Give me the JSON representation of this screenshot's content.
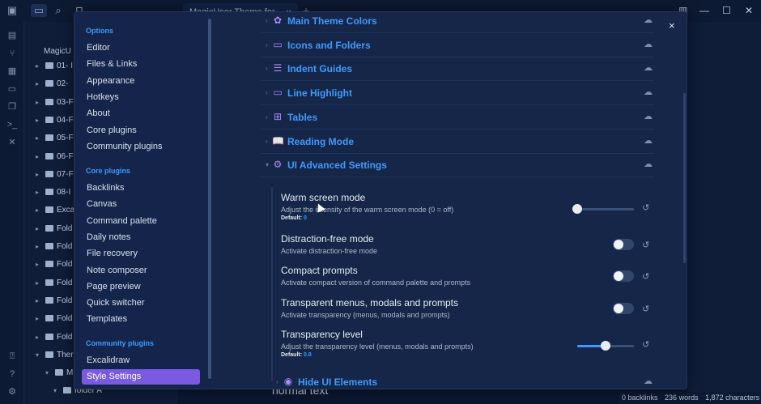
{
  "titlebar": {
    "tab_title": "MagicUser Theme for ...",
    "tab_close": "×",
    "tab_plus": "+",
    "icons": [
      "sidebar-toggle-icon",
      "folder-icon",
      "search-icon",
      "bookmark-icon"
    ],
    "window_controls": {
      "chevron": "⌄",
      "layout": "▥",
      "minimize": "—",
      "maximize": "☐",
      "close": "✕"
    }
  },
  "ribbon": {
    "icons": [
      "file-icon",
      "graph-icon",
      "blocks-icon",
      "calendar-icon",
      "copy-icon",
      "terminal-icon",
      "tools-icon",
      "help-icon",
      "question-icon",
      "settings-icon"
    ]
  },
  "explorer": {
    "vault": "MagicU",
    "rows": [
      {
        "label": "01- I",
        "expanded": false
      },
      {
        "label": "02- ",
        "expanded": false
      },
      {
        "label": "03-F",
        "expanded": false
      },
      {
        "label": "04-F",
        "expanded": false
      },
      {
        "label": "05-F",
        "expanded": false
      },
      {
        "label": "06-F",
        "expanded": false
      },
      {
        "label": "07-F",
        "expanded": false
      },
      {
        "label": "08-I",
        "expanded": false
      },
      {
        "label": "Exca",
        "expanded": false
      },
      {
        "label": "Fold",
        "expanded": false
      },
      {
        "label": "Fold",
        "expanded": false
      },
      {
        "label": "Fold",
        "expanded": false
      },
      {
        "label": "Fold",
        "expanded": false
      },
      {
        "label": "Fold",
        "expanded": false
      },
      {
        "label": "Fold",
        "expanded": false
      },
      {
        "label": "Fold",
        "expanded": false
      },
      {
        "label": "Ther",
        "expanded": true
      },
      {
        "label": "M",
        "expanded": true
      },
      {
        "label": "folder A",
        "expanded": true
      }
    ]
  },
  "editor": {
    "normal_text": "normal text",
    "status": {
      "backlinks": "0 backlinks",
      "words": "236 words",
      "characters": "1,872 characters"
    }
  },
  "settings_nav": {
    "groups": [
      {
        "title": "Options",
        "items": [
          "Editor",
          "Files & Links",
          "Appearance",
          "Hotkeys",
          "About",
          "Core plugins",
          "Community plugins"
        ]
      },
      {
        "title": "Core plugins",
        "items": [
          "Backlinks",
          "Canvas",
          "Command palette",
          "Daily notes",
          "File recovery",
          "Note composer",
          "Page preview",
          "Quick switcher",
          "Templates"
        ]
      },
      {
        "title": "Community plugins",
        "items": [
          "Excalidraw",
          "Style Settings"
        ]
      }
    ],
    "active_item": "Style Settings"
  },
  "modal": {
    "close": "×",
    "sections": [
      {
        "title": "Main Theme Colors",
        "icon": "palette-icon",
        "glyph": "✿",
        "expanded": false
      },
      {
        "title": "Icons and Folders",
        "icon": "folder-icon",
        "glyph": "▭",
        "expanded": false
      },
      {
        "title": "Indent Guides",
        "icon": "list-indent-icon",
        "glyph": "☰",
        "expanded": false
      },
      {
        "title": "Line Highlight",
        "icon": "highlight-icon",
        "glyph": "▭",
        "expanded": false
      },
      {
        "title": "Tables",
        "icon": "table-icon",
        "glyph": "⊞",
        "expanded": false
      },
      {
        "title": "Reading Mode",
        "icon": "book-open-icon",
        "glyph": "📖",
        "expanded": false
      },
      {
        "title": "UI Advanced Settings",
        "icon": "sliders-icon",
        "glyph": "⚙",
        "expanded": true
      }
    ],
    "section_cloud_glyph": "☁",
    "settings": [
      {
        "name": "Warm screen mode",
        "description": "Adjust the intensity of the warm screen mode (0 = off)",
        "default_label": "Default:",
        "default_value": "0",
        "control": "slider",
        "value": 0,
        "min": 0,
        "max": 1
      },
      {
        "name": "Distraction-free mode",
        "description": "Activate distraction-free mode",
        "control": "toggle",
        "value": false
      },
      {
        "name": "Compact prompts",
        "description": "Activate compact version of command palette and prompts",
        "control": "toggle",
        "value": false
      },
      {
        "name": "Transparent menus, modals and prompts",
        "description": "Activate transparency (menus, modals and prompts)",
        "control": "toggle",
        "value": false
      },
      {
        "name": "Transparency level",
        "description": "Adjust the transparency level (menus, modals and prompts)",
        "default_label": "Default:",
        "default_value": "0.8",
        "control": "slider",
        "value": 0.5,
        "min": 0,
        "max": 1
      }
    ],
    "reset_glyph": "↺",
    "next_section": {
      "title": "Hide UI Elements",
      "icon": "eye-off-icon",
      "glyph": "◉",
      "expanded": false
    }
  },
  "colors": {
    "accent": "#3d9bff",
    "active_nav": "#7a5ae0",
    "icon_purple": "#a98bff",
    "modal_bg": "#152648"
  }
}
